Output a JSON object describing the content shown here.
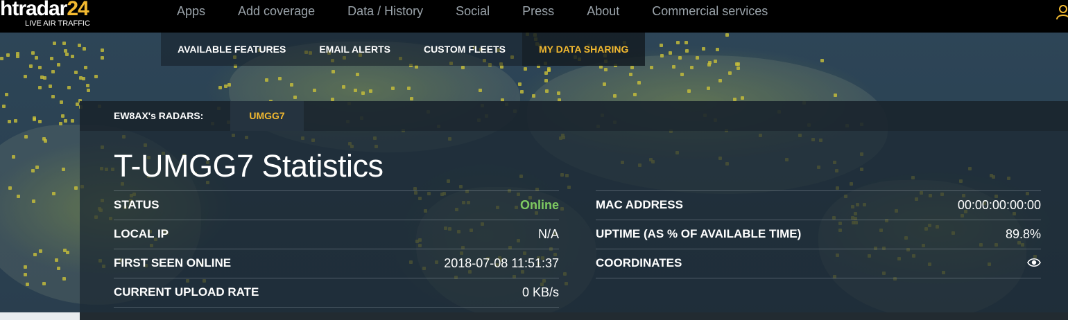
{
  "app": {
    "logo_text": "htradar",
    "logo_accent": "24",
    "logo_subtitle": "LIVE AIR TRAFFIC",
    "accent_color": "#f2b930"
  },
  "nav": {
    "items": [
      {
        "label": "Apps"
      },
      {
        "label": "Add coverage"
      },
      {
        "label": "Data / History"
      },
      {
        "label": "Social"
      },
      {
        "label": "Press"
      },
      {
        "label": "About"
      },
      {
        "label": "Commercial services"
      }
    ],
    "user_icon": "user-icon"
  },
  "subnav": {
    "items": [
      {
        "label": "AVAILABLE FEATURES",
        "active": false
      },
      {
        "label": "EMAIL ALERTS",
        "active": false
      },
      {
        "label": "CUSTOM FLEETS",
        "active": false
      },
      {
        "label": "MY DATA SHARING",
        "active": true
      }
    ]
  },
  "radars": {
    "label": "EW8AX's RADARS:",
    "tabs": [
      {
        "label": "UMGG7",
        "active": true
      }
    ]
  },
  "page": {
    "title": "T-UMGG7 Statistics"
  },
  "stats": {
    "left": [
      {
        "key": "STATUS",
        "value": "Online",
        "status_color": "#7ecb62"
      },
      {
        "key": "LOCAL IP",
        "value": "N/A"
      },
      {
        "key": "FIRST SEEN ONLINE",
        "value": "2018-07-08 11:51:37"
      },
      {
        "key": "CURRENT UPLOAD RATE",
        "value": "0 KB/s"
      }
    ],
    "right": [
      {
        "key": "MAC ADDRESS",
        "value": "00:00:00:00:00"
      },
      {
        "key": "UPTIME (AS % OF AVAILABLE TIME)",
        "value": "89.8%"
      },
      {
        "key": "COORDINATES",
        "value_icon": "eye-icon"
      }
    ]
  }
}
